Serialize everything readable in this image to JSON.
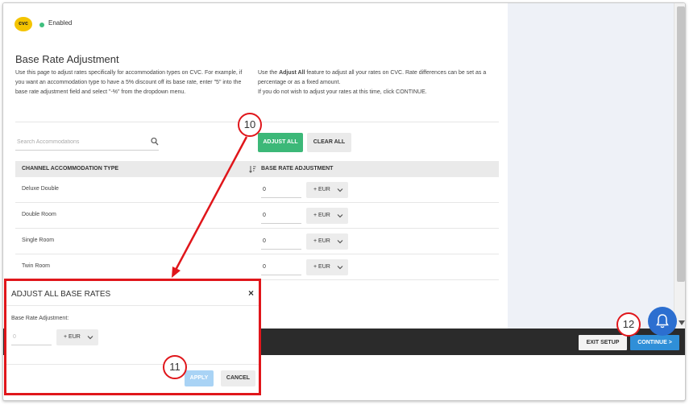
{
  "header": {
    "logo_text": "cvc",
    "status_text": "Enabled",
    "status_color": "#3fbf7f"
  },
  "page": {
    "title": "Base Rate Adjustment",
    "description_left": "Use this page to adjust rates specifically for accommodation types on CVC. For example, if you want an accommodation type to have a 5% discount off its base rate, enter \"5\" into the base rate adjustment field and select \"-%\" from the dropdown menu.",
    "description_right_pre": "Use the ",
    "description_right_bold": "Adjust All",
    "description_right_post": " feature to adjust all your rates on CVC. Rate differences can be set as a percentage or as a fixed amount.",
    "description_right_line2": "If you do not wish to adjust your rates at this time, click CONTINUE."
  },
  "search": {
    "placeholder": "Search Accommodations",
    "icon": "search-icon"
  },
  "actions": {
    "adjust_all_label": "ADJUST ALL",
    "clear_all_label": "CLEAR ALL",
    "adjust_color": "#3cb878"
  },
  "table": {
    "headers": [
      "CHANNEL ACCOMMODATION TYPE",
      "BASE RATE ADJUSTMENT"
    ],
    "rows": [
      {
        "name": "Deluxe Double",
        "value": "0",
        "unit": "+ EUR"
      },
      {
        "name": "Double Room",
        "value": "0",
        "unit": "+ EUR"
      },
      {
        "name": "Single Room",
        "value": "0",
        "unit": "+ EUR"
      },
      {
        "name": "Twin Room",
        "value": "0",
        "unit": "+ EUR"
      }
    ]
  },
  "modal": {
    "title": "ADJUST ALL BASE RATES",
    "close_symbol": "×",
    "field_label": "Base Rate Adjustment:",
    "input_placeholder": "0",
    "unit": "+ EUR",
    "apply_label": "APPLY",
    "cancel_label": "CANCEL"
  },
  "footer": {
    "exit_label": "EXIT SETUP",
    "continue_label": "CONTINUE >",
    "continue_color": "#2f8fd8"
  },
  "callouts": [
    "10",
    "11",
    "12"
  ],
  "annotation_color": "#e0161b"
}
